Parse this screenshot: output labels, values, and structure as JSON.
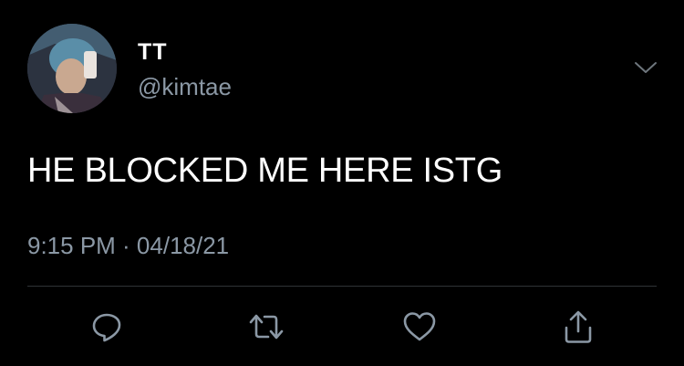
{
  "user": {
    "display_name": "TT",
    "handle": "@kimtae",
    "avatar_icon": "profile-photo"
  },
  "tweet": {
    "text": "HE BLOCKED ME HERE ISTG",
    "timestamp": "9:15 PM · 04/18/21"
  },
  "actions": {
    "reply_icon": "reply-icon",
    "retweet_icon": "retweet-icon",
    "like_icon": "heart-icon",
    "share_icon": "share-icon",
    "menu_icon": "chevron-down-icon"
  },
  "colors": {
    "background": "#000000",
    "primary_text": "#ffffff",
    "secondary_text": "#8b98a5",
    "divider": "#2f3336"
  }
}
